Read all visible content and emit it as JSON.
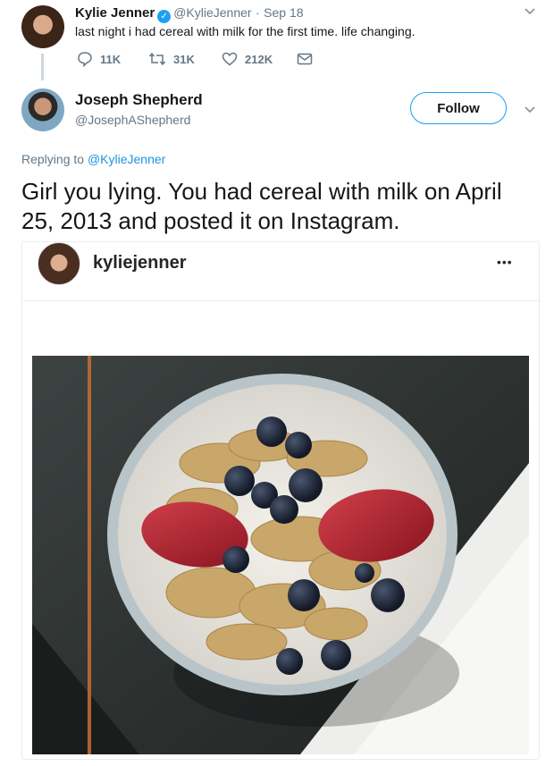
{
  "tweet1": {
    "name": "Kylie Jenner",
    "handle": "@KylieJenner",
    "separator": "·",
    "date": "Sep 18",
    "text": "last night i had cereal with milk for the first time. life changing.",
    "replies": "11K",
    "retweets": "31K",
    "likes": "212K"
  },
  "tweet2": {
    "name": "Joseph Shepherd",
    "handle": "@JosephAShepherd",
    "follow_label": "Follow",
    "replying_prefix": "Replying to",
    "replying_to": "@KylieJenner",
    "text": "Girl you lying. You had cereal with milk on April 25, 2013 and posted it on Instagram."
  },
  "instagram": {
    "username": "kyliejenner",
    "more_label": "•••"
  },
  "icons": {
    "reply": "speech-bubble-icon",
    "retweet": "retweet-icon",
    "like": "heart-icon",
    "dm": "envelope-icon",
    "verified": "verified-badge-icon",
    "menu": "chevron-down-icon"
  },
  "colors": {
    "accent": "#1da1f2",
    "muted": "#657786",
    "text": "#14171a"
  }
}
